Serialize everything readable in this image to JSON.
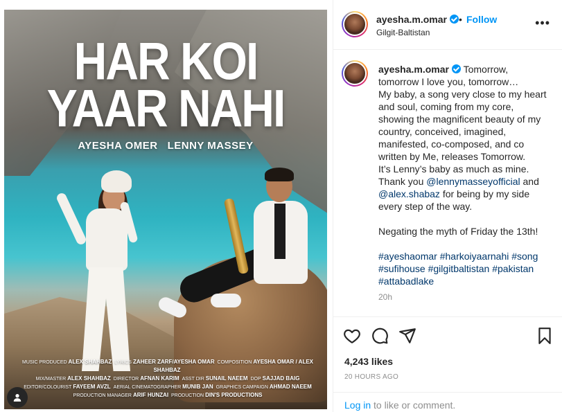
{
  "poster": {
    "title_line1": "HAR KOI",
    "title_line2": "YAAR NAHI",
    "artist1": "AYESHA OMER",
    "artist2": "LENNY MASSEY",
    "credits": [
      [
        "MUSIC PRODUCED",
        "ALEX SHAHBAZ",
        "LYRICS",
        "ZAHEER ZARF/AYESHA OMAR",
        "COMPOSITION",
        "AYESHA OMAR / ALEX SHAHBAZ"
      ],
      [
        "MIX/MASTER",
        "ALEX SHAHBAZ",
        "DIRECTOR",
        "AFNAN KARIM",
        "ASST DIR",
        "SUNAIL NAEEM",
        "DOP",
        "SAJJAD BAIG"
      ],
      [
        "EDITOR/COLOURIST",
        "FAYEEM AVZL",
        "AERIAL CINEMATOGRAPHER",
        "MUNIB JAN",
        "GRAPHICS CAMPAIGN",
        "AHMAD NAEEM"
      ],
      [
        "PRODUCTION MANAGER",
        "ARIF HUNZAI",
        "PRODUCTION",
        "DIN'S PRODUCTIONS"
      ]
    ]
  },
  "header": {
    "username": "ayesha.m.omar",
    "separator": "•",
    "follow_label": "Follow",
    "location": "Gilgit-Baltistan",
    "more_label": "•••"
  },
  "caption": {
    "username": "ayesha.m.omar",
    "text_part1": " Tomorrow, tomorrow I love you, tomorrow…\nMy baby, a song very close to my heart and soul, coming from my core, showing the magnificent beauty of my country, conceived, imagined, manifested, co-composed, and co written by Me, releases Tomorrow.\nIt’s Lenny’s baby as much as mine.\nThank you ",
    "mention1": "@lennymasseyofficial",
    "text_part2": " and ",
    "mention2": "@alex.shabaz",
    "text_part3": " for being by my side every step of the way.\n\nNegating the myth of Friday the 13th!\n\n",
    "hashtags": [
      "#ayeshaomar",
      "#harkoiyaarnahi",
      "#song",
      "#sufihouse",
      "#gilgitbaltistan",
      "#pakistan",
      "#attabadlake"
    ],
    "time": "20h"
  },
  "actions": {
    "like_icon": "heart-icon",
    "comment_icon": "comment-icon",
    "share_icon": "share-icon",
    "save_icon": "bookmark-icon"
  },
  "likes": "4,243 likes",
  "posted_ago": "20 HOURS AGO",
  "login": {
    "link": "Log in",
    "rest": " to like or comment."
  },
  "colors": {
    "accent": "#0095f6",
    "mention": "#00376b",
    "muted": "#8e8e8e",
    "text": "#262626"
  }
}
